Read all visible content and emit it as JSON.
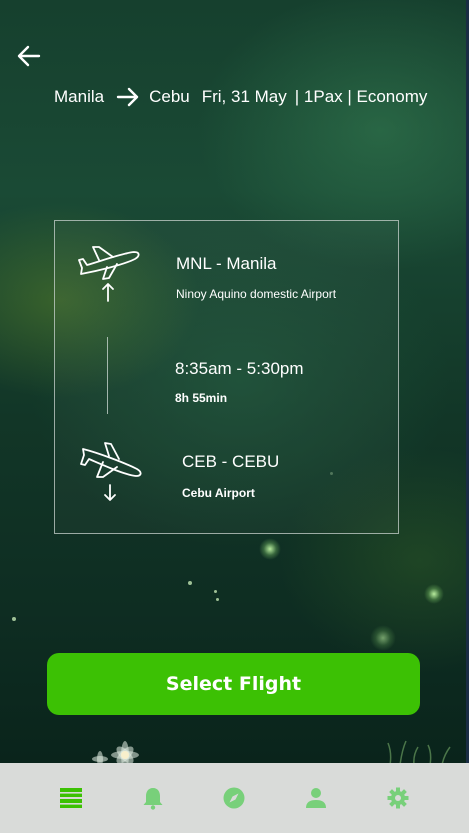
{
  "header": {
    "origin": "Manila",
    "destination": "Cebu",
    "date": "Fri, 31 May",
    "details": "| 1Pax | Economy"
  },
  "flight": {
    "departure": {
      "code": "MNL - Manila",
      "airport": "Ninoy Aquino domestic Airport"
    },
    "times": "8:35am - 5:30pm",
    "duration": "8h 55min",
    "arrival": {
      "code": "CEB - CEBU",
      "airport": "Cebu Airport"
    }
  },
  "actions": {
    "select_label": "Select Flight"
  },
  "nav": {
    "items": [
      {
        "icon": "list-icon",
        "active": true
      },
      {
        "icon": "bell-icon",
        "active": false
      },
      {
        "icon": "compass-icon",
        "active": false
      },
      {
        "icon": "person-icon",
        "active": false
      },
      {
        "icon": "gear-icon",
        "active": false
      }
    ]
  },
  "colors": {
    "accent": "#3cc104",
    "nav_active": "#3cc104",
    "nav_inactive": "#78d07a",
    "nav_background": "#d9dbd9"
  }
}
